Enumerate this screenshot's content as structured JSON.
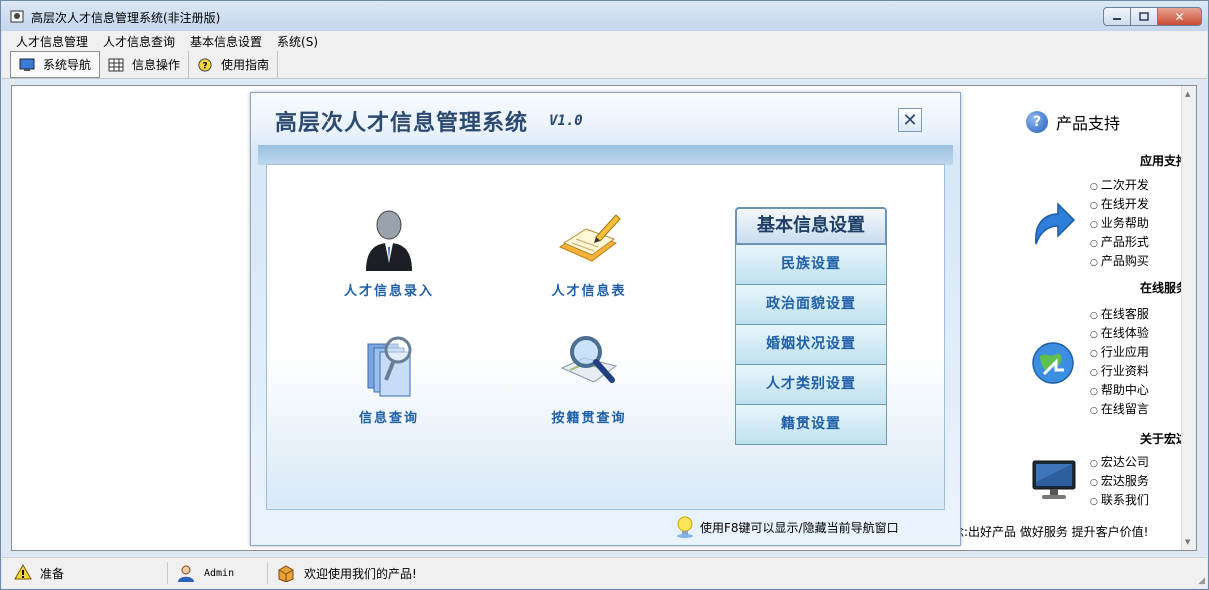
{
  "window": {
    "title": "高层次人才信息管理系统(非注册版)",
    "controls": {
      "minimize": "–",
      "maximize": "□",
      "close": "✕"
    }
  },
  "menubar": [
    {
      "label": "人才信息管理"
    },
    {
      "label": "人才信息查询"
    },
    {
      "label": "基本信息设置"
    },
    {
      "label": "系统(S)"
    }
  ],
  "toolbar": [
    {
      "label": "系统导航",
      "icon": "monitor-icon",
      "active": true
    },
    {
      "label": "信息操作",
      "icon": "grid-icon",
      "active": false
    },
    {
      "label": "使用指南",
      "icon": "help-icon",
      "active": false
    }
  ],
  "dialog": {
    "title": "高层次人才信息管理系统",
    "version": "V1.0",
    "close": "✕",
    "features": [
      {
        "label": "人才信息录入",
        "icon": "person-icon"
      },
      {
        "label": "人才信息表",
        "icon": "notepad-pencil-icon"
      },
      {
        "label": "信息查询",
        "icon": "documents-magnifier-icon"
      },
      {
        "label": "按籍贯查询",
        "icon": "map-magnifier-icon"
      }
    ],
    "settings": {
      "header": "基本信息设置",
      "items": [
        {
          "label": "民族设置"
        },
        {
          "label": "政治面貌设置"
        },
        {
          "label": "婚姻状况设置"
        },
        {
          "label": "人才类别设置"
        },
        {
          "label": "籍贯设置"
        }
      ]
    },
    "tip": "使用F8键可以显示/隐藏当前导航窗口"
  },
  "right_panel": {
    "title": "产品支持",
    "sections": [
      {
        "heading": "应用支持",
        "icon": "blue-arrow-icon",
        "links": [
          "二次开发",
          "在线开发",
          "业务帮助",
          "产品形式",
          "产品购买"
        ]
      },
      {
        "heading": "在线服务",
        "icon": "globe-icon",
        "links": [
          "在线客服",
          "在线体验",
          "行业应用",
          "行业资料",
          "帮助中心",
          "在线留言"
        ]
      },
      {
        "heading": "关于宏达",
        "icon": "monitor-icon",
        "links": [
          "宏达公司",
          "宏达服务",
          "联系我们"
        ]
      }
    ],
    "motto": "念:出好产品 做好服务 提升客户价值!"
  },
  "statusbar": {
    "status": "准备",
    "user": "Admin",
    "message": "欢迎使用我们的产品!"
  }
}
